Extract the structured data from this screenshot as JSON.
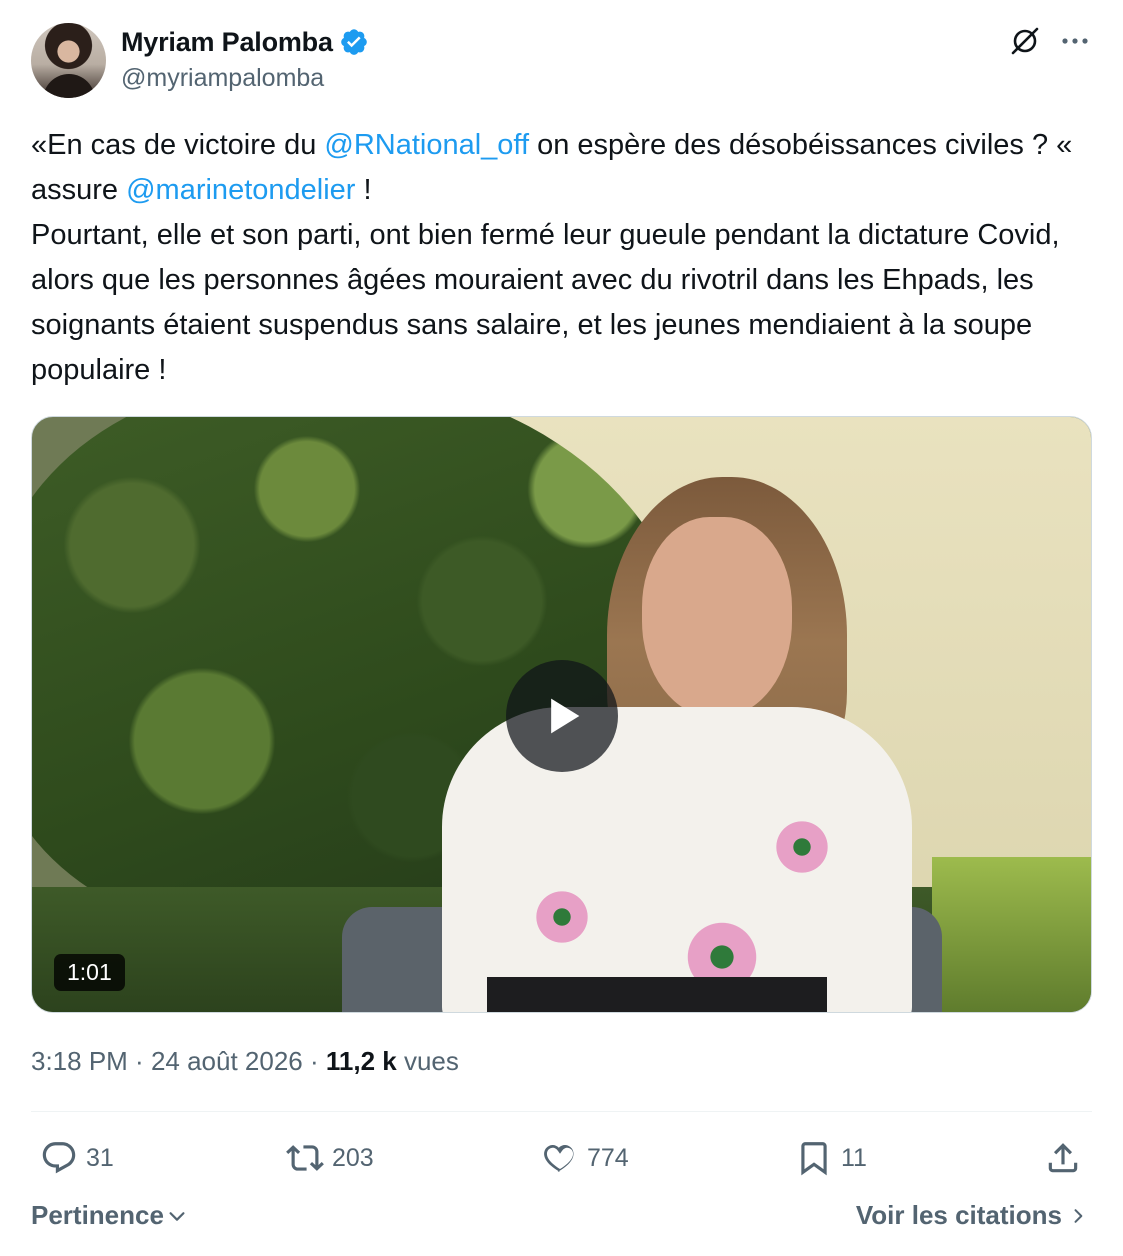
{
  "author": {
    "display_name": "Myriam Palomba",
    "handle": "@myriampalomba",
    "verified": true,
    "verified_color": "#1d9bf0"
  },
  "header_icons": [
    "grok-icon",
    "more-icon"
  ],
  "tweet": {
    "segments": [
      {
        "type": "text",
        "text": "«En cas de victoire du "
      },
      {
        "type": "mention",
        "text": "@RNational_off"
      },
      {
        "type": "text",
        "text": " on espère des désobéissances civiles ? «  assure "
      },
      {
        "type": "mention",
        "text": "@marinetondelier"
      },
      {
        "type": "text",
        "text": " !\nPourtant, elle et son parti, ont bien fermé leur gueule pendant la dictature Covid, alors que les personnes âgées mouraient avec du rivotril dans les Ehpads, les soignants étaient suspendus sans salaire, et les jeunes mendiaient à la soupe populaire !"
      }
    ]
  },
  "media": {
    "type": "video",
    "duration": "1:01",
    "play_icon": "play-icon"
  },
  "meta": {
    "time": "3:18 PM",
    "separator": " · ",
    "date": "24 août 2026",
    "views_count": "11,2 k",
    "views_label": "vues"
  },
  "actions": {
    "replies": "31",
    "retweets": "203",
    "likes": "774",
    "bookmarks": "11"
  },
  "footer": {
    "sort_label": "Pertinence",
    "quotes_label": "Voir les citations"
  },
  "colors": {
    "text_primary": "#0f1419",
    "text_secondary": "#536471",
    "link": "#1d9bf0",
    "divider": "#eff3f4"
  }
}
